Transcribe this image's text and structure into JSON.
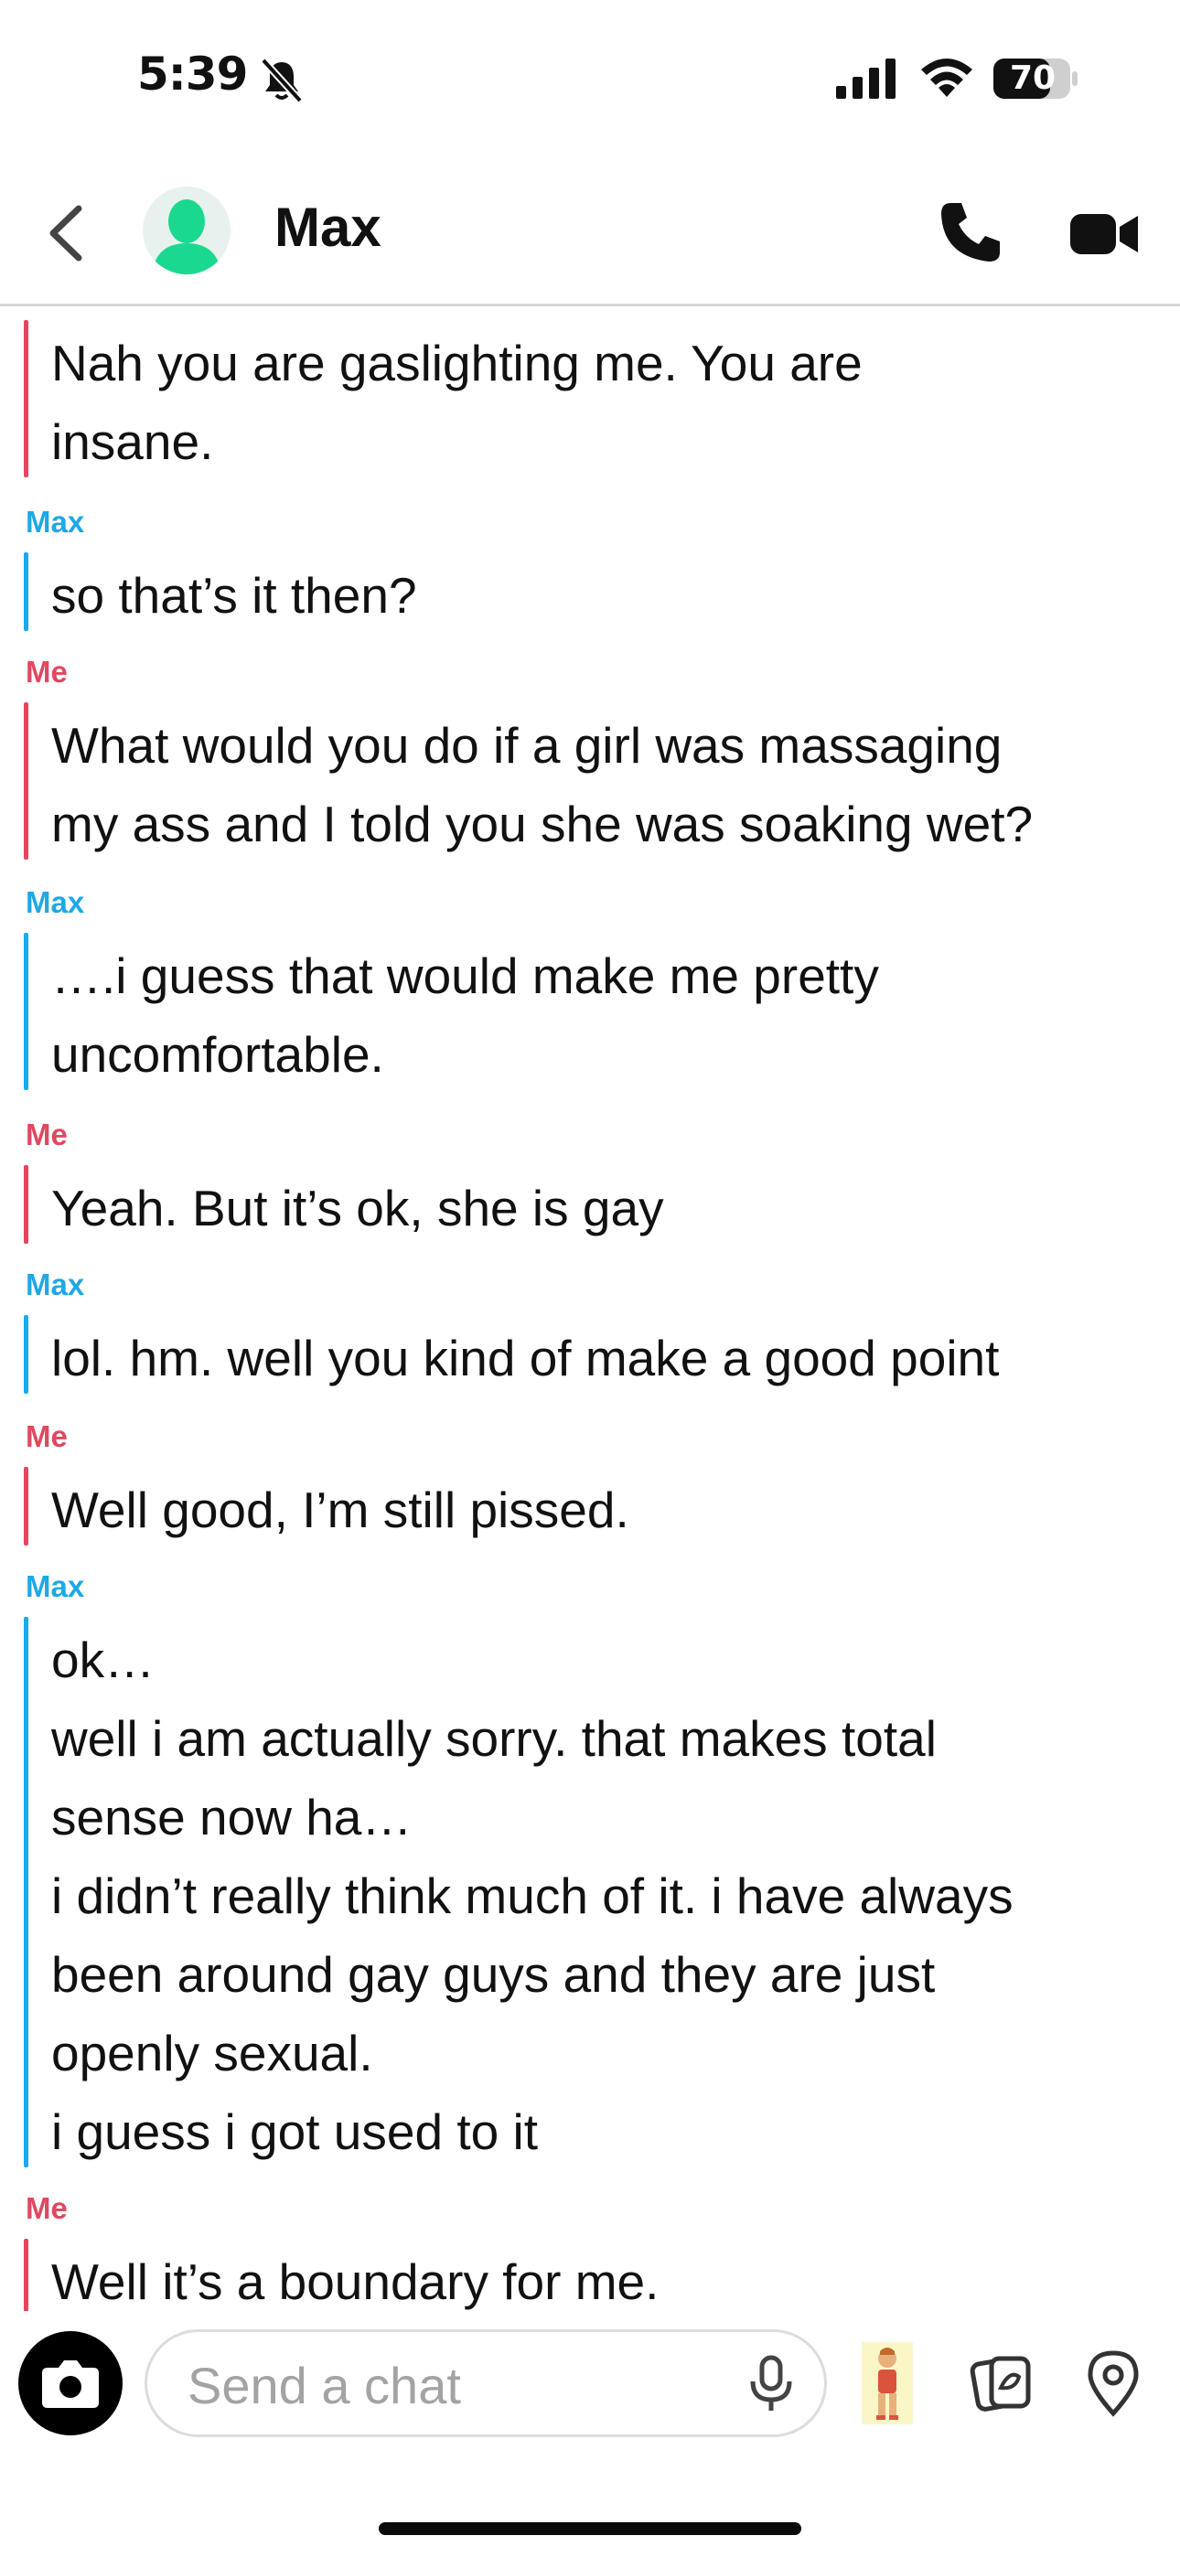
{
  "status_bar": {
    "time": "5:39",
    "battery": "70",
    "icons": [
      "bell-slash-icon",
      "signal-icon",
      "wifi-icon",
      "battery-icon"
    ]
  },
  "header": {
    "contact_name": "Max",
    "icons": [
      "back-chevron-icon",
      "avatar-icon",
      "phone-icon",
      "video-icon"
    ]
  },
  "colors": {
    "max": "#1ea8e6",
    "me": "#e0485f",
    "avatar_green": "#1bd88f"
  },
  "messages": [
    {
      "sender": "",
      "side": "me",
      "text": "Nah you are gaslighting me. You are\ninsane."
    },
    {
      "sender": "Max",
      "side": "max",
      "text": "so that’s it then?"
    },
    {
      "sender": "Me",
      "side": "me",
      "text": "What would you do if a girl was massaging\nmy ass and I told you she was soaking wet?"
    },
    {
      "sender": "Max",
      "side": "max",
      "text": "….i guess that would make me pretty\nuncomfortable."
    },
    {
      "sender": "Me",
      "side": "me",
      "text": "Yeah. But it’s ok, she is gay"
    },
    {
      "sender": "Max",
      "side": "max",
      "text": "lol. hm. well you kind of make a good point"
    },
    {
      "sender": "Me",
      "side": "me",
      "text": "Well good, I’m still pissed."
    },
    {
      "sender": "Max",
      "side": "max",
      "text": "ok…\nwell i am actually sorry. that makes total\nsense now ha…\ni didn’t really think much of it. i have always\nbeen around gay guys and they are just\nopenly sexual.\ni guess i got used to it"
    },
    {
      "sender": "Me",
      "side": "me",
      "text": "Well it’s a boundary for me."
    }
  ],
  "input": {
    "placeholder": "Send a chat",
    "value": ""
  },
  "bottom_icons": [
    "camera-icon",
    "microphone-icon",
    "bitmoji-icon",
    "cards-icon",
    "location-pin-icon"
  ]
}
